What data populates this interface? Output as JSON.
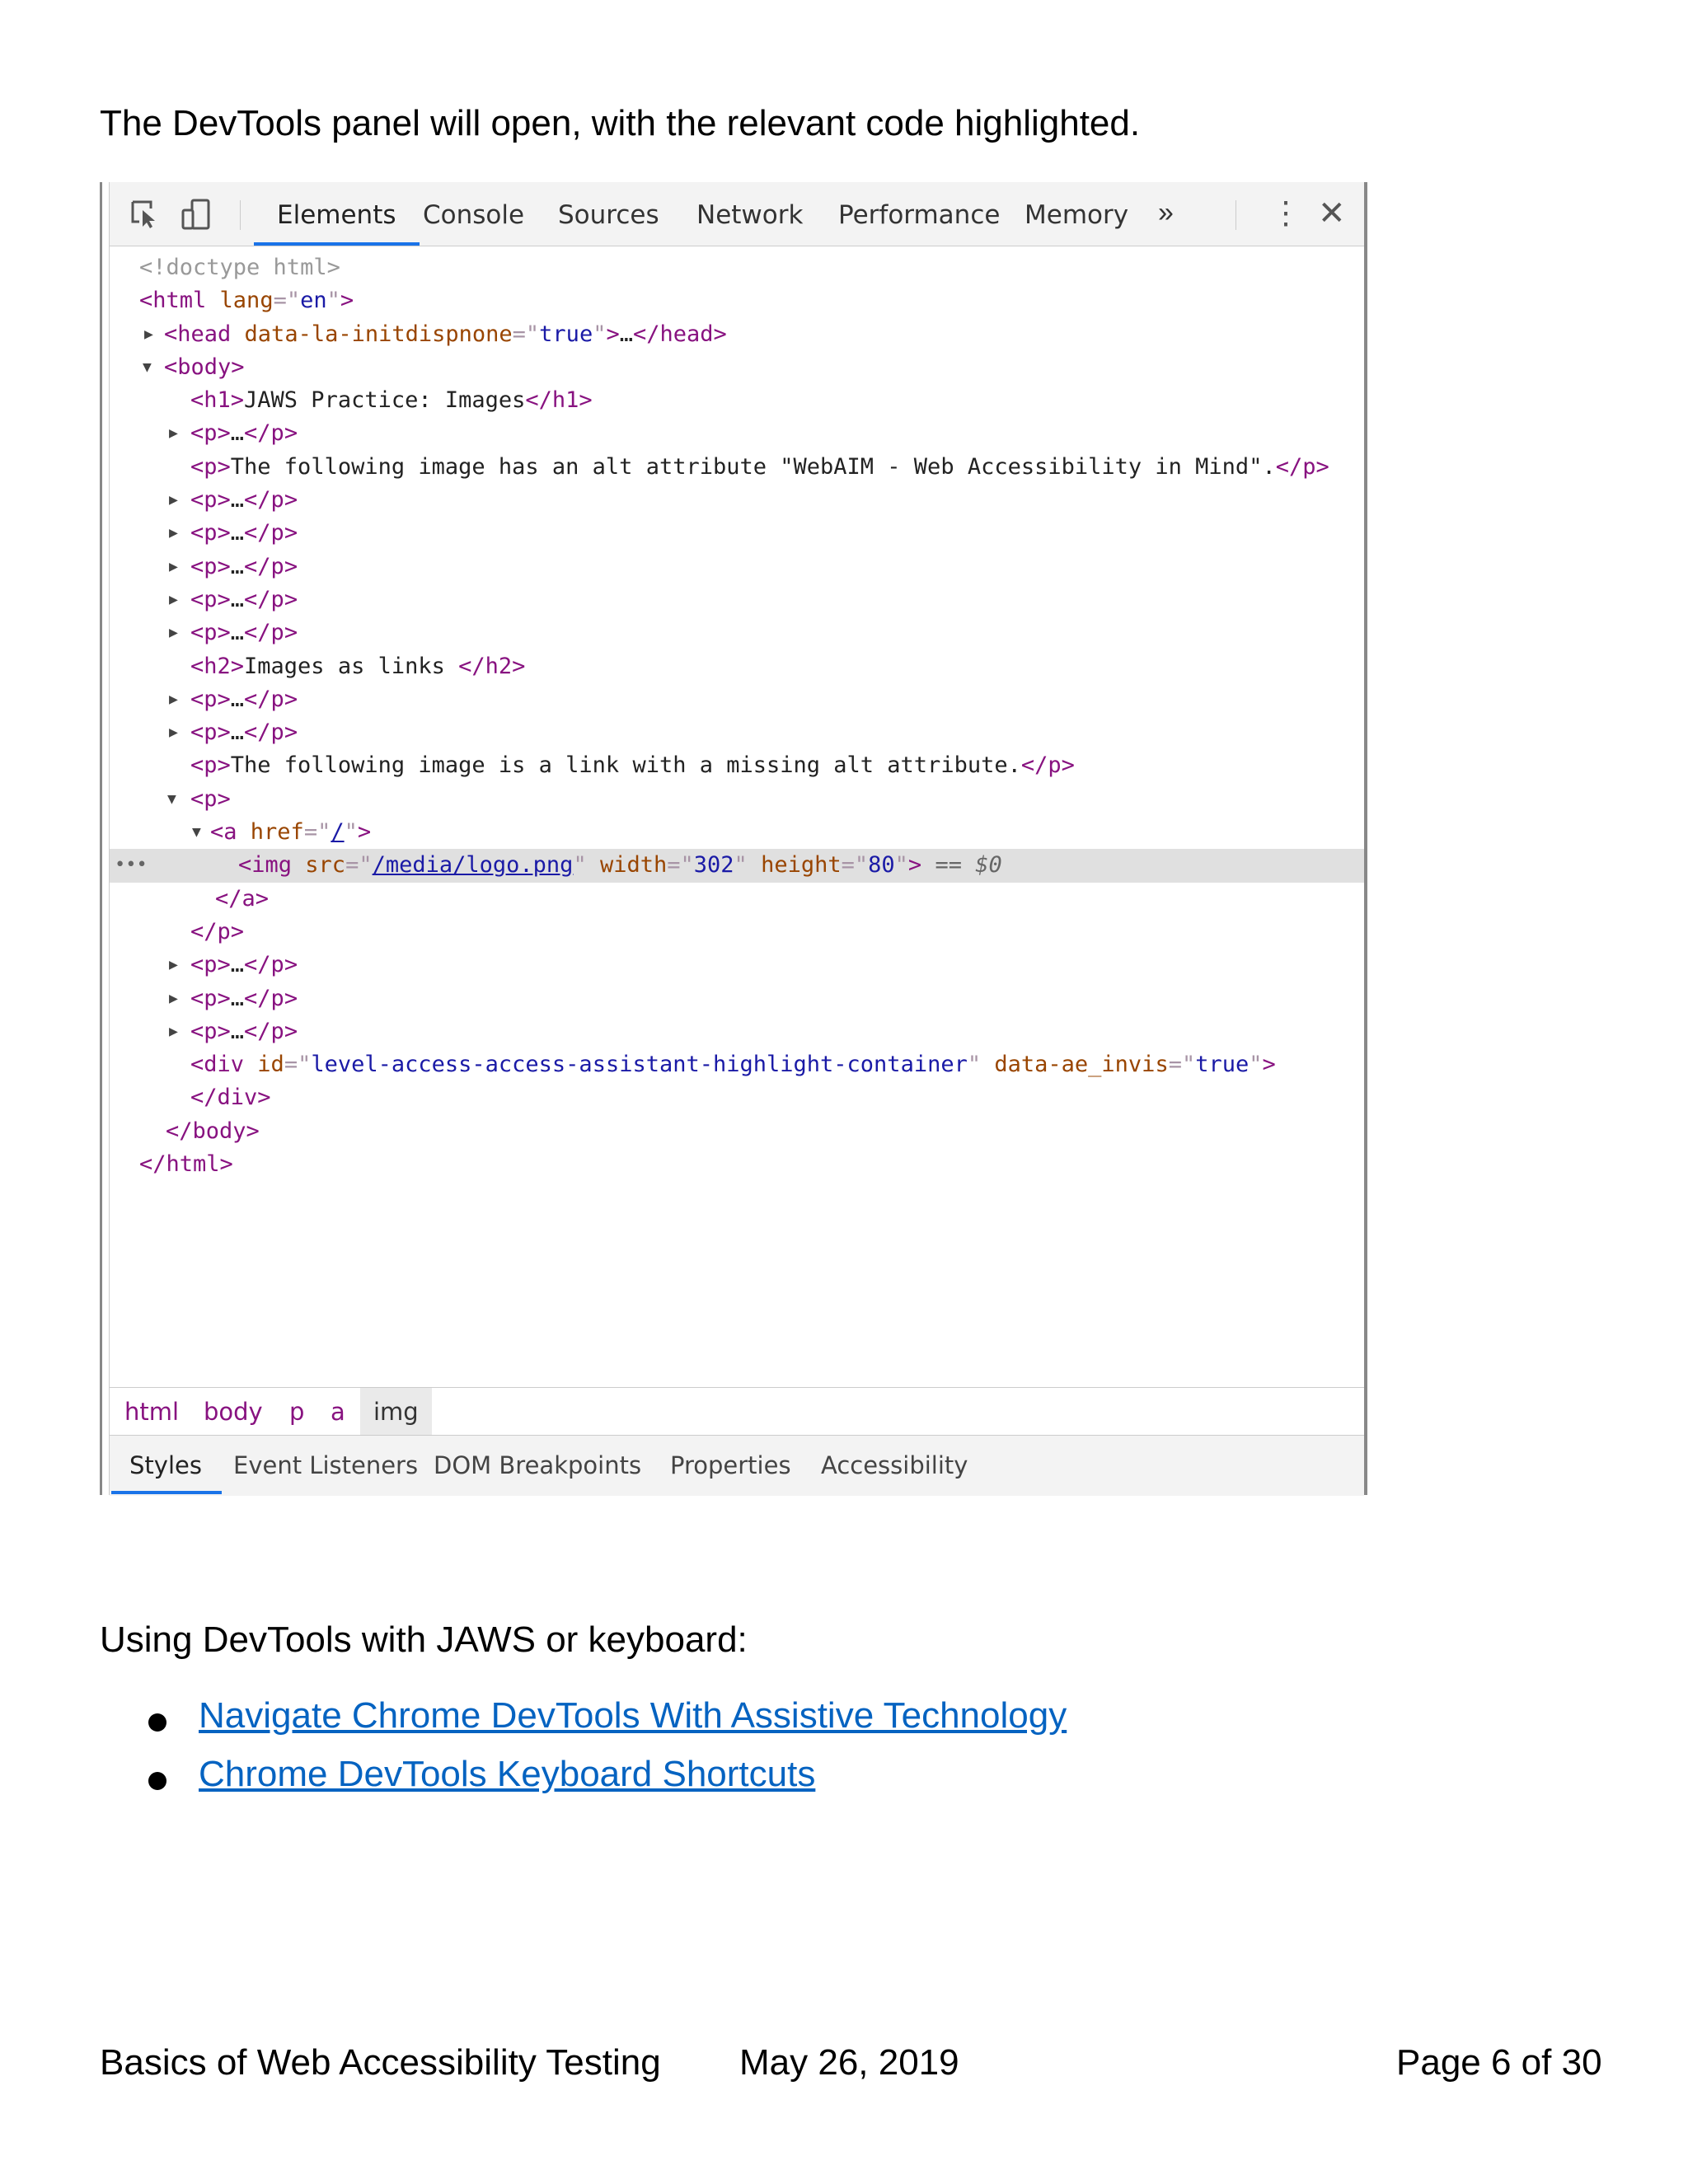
{
  "intro_text": "The DevTools panel will open, with the relevant code highlighted.",
  "devtools": {
    "tabs": [
      "Elements",
      "Console",
      "Sources",
      "Network",
      "Performance",
      "Memory"
    ],
    "active_tab": "Elements",
    "overflow_label": "»",
    "code": {
      "doctype": "<!doctype html>",
      "html_lang": "en",
      "head_attr_name": "data-la-initdispnone",
      "head_attr_value": "true",
      "h1_text": "JAWS Practice: Images",
      "p_alt_text": "The following image has an alt attribute \"WebAIM - Web Accessibility in Mind\".",
      "h2_text": "Images as links ",
      "p_missing_text": "The following image is a link with a missing alt attribute.",
      "a_href": "/",
      "img_src": "/media/logo.png",
      "img_width": "302",
      "img_height": "80",
      "selected_marker": "== $0",
      "div_id": "level-access-access-assistant-highlight-container",
      "div_attr_name": "data-ae_invis",
      "div_attr_value": "true"
    },
    "breadcrumbs": [
      "html",
      "body",
      "p",
      "a",
      "img"
    ],
    "subtabs": [
      "Styles",
      "Event Listeners",
      "DOM Breakpoints",
      "Properties",
      "Accessibility"
    ],
    "active_subtab": "Styles"
  },
  "section_heading": "Using DevTools with JAWS or keyboard:",
  "links": [
    "Navigate Chrome DevTools With Assistive Technology",
    "Chrome DevTools Keyboard Shortcuts"
  ],
  "footer": {
    "title": "Basics of Web Accessibility Testing",
    "date": "May 26, 2019",
    "page": "Page 6 of 30"
  }
}
